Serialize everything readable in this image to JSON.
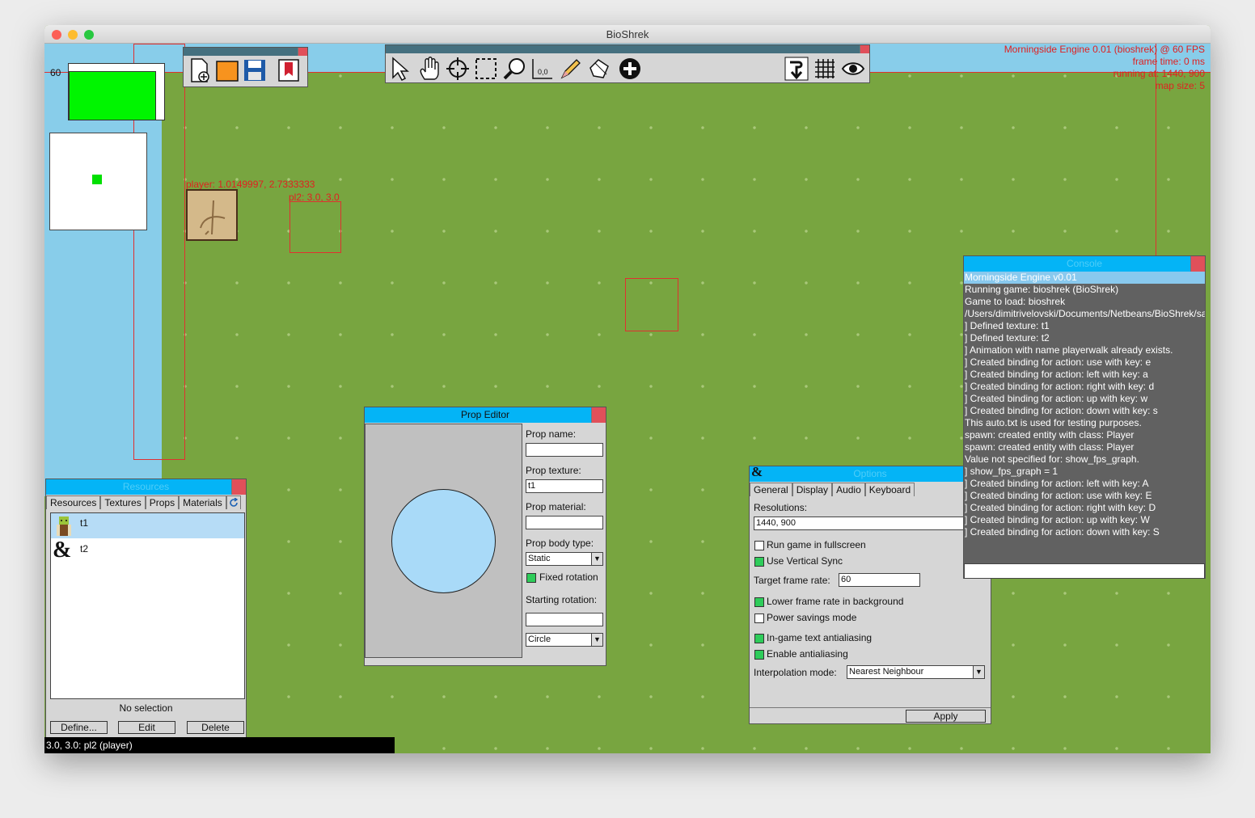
{
  "app": {
    "title": "BioShrek"
  },
  "hud": {
    "minimap_value": "60",
    "player_label": "player: 1.0149997, 2.7333333",
    "pl2_label": "pl2: 3.0, 3.0",
    "stats": [
      "Morningside Engine 0.01 (bioshrek) @ 60 FPS",
      "frame time: 0 ms",
      "running at: 1440, 900",
      "map size: 5"
    ],
    "status_bar": "3.0, 3.0: pl2 (player)"
  },
  "file_toolbar": {
    "icons": [
      "new-file-icon",
      "open-folder-icon",
      "save-icon",
      "bookmark-icon"
    ]
  },
  "tools_toolbar": {
    "icons": [
      "pointer-icon",
      "hand-icon",
      "crosshair-icon",
      "marquee-select-icon",
      "zoom-icon",
      "coordinates-icon",
      "pencil-icon",
      "polygon-icon",
      "add-icon",
      "step-down-icon",
      "grid-icon",
      "eye-icon"
    ],
    "coords_glyph": "0,0"
  },
  "resources": {
    "title": "Resources",
    "tabs": [
      "Resources",
      "Textures",
      "Props",
      "Materials"
    ],
    "items": [
      {
        "name": "t1",
        "icon": "shrek-thumbnail-icon"
      },
      {
        "name": "t2",
        "icon": "ampersand-icon",
        "glyph": "&"
      }
    ],
    "status": "No selection",
    "buttons": {
      "define": "Define...",
      "edit": "Edit",
      "delete": "Delete"
    }
  },
  "prop_editor": {
    "title": "Prop Editor",
    "prop_name_label": "Prop name:",
    "prop_name_value": "",
    "prop_texture_label": "Prop texture:",
    "prop_texture_value": "t1",
    "prop_material_label": "Prop material:",
    "prop_material_value": "",
    "body_type_label": "Prop body type:",
    "body_type_value": "Static",
    "fixed_rotation_label": "Fixed rotation",
    "fixed_rotation_checked": true,
    "starting_rotation_label": "Starting rotation:",
    "starting_rotation_value": "",
    "shape_value": "Circle",
    "arrow_glyph": "▼"
  },
  "options": {
    "title": "Options",
    "icon_glyph": "&",
    "tabs": [
      "General",
      "Display",
      "Audio",
      "Keyboard"
    ],
    "resolutions_label": "Resolutions:",
    "resolutions_value": "1440, 900",
    "fullscreen_label": "Run game in fullscreen",
    "fullscreen_checked": false,
    "vsync_label": "Use Vertical Sync",
    "vsync_checked": true,
    "target_fps_label": "Target frame rate:",
    "target_fps_value": "60",
    "lower_fps_label": "Lower frame rate in background",
    "lower_fps_checked": true,
    "power_label": "Power savings mode",
    "power_checked": false,
    "text_aa_label": "In-game text antialiasing",
    "text_aa_checked": true,
    "aa_label": "Enable antialiasing",
    "aa_checked": true,
    "interp_label": "Interpolation mode:",
    "interp_value": "Nearest Neighbour",
    "apply_label": "Apply"
  },
  "console": {
    "title": "Console",
    "lines": [
      "Morningside Engine v0.01",
      "Running game: bioshrek (BioShrek)",
      "Game to load: bioshrek",
      "/Users/dimitrivelovski/Documents/Netbeans/BioShrek/sa",
      "] Defined texture: t1",
      "] Defined texture: t2",
      "] Animation with name playerwalk already exists.",
      "] Created binding for action: use with key: e",
      "] Created binding for action: left with key: a",
      "] Created binding for action: right with key: d",
      "] Created binding for action: up with key: w",
      "] Created binding for action: down with key: s",
      "This auto.txt is used for testing purposes.",
      "spawn: created entity with class: Player",
      "spawn: created entity with class: Player",
      "Value not specified for: show_fps_graph.",
      "] show_fps_graph = 1",
      "] Created binding for action: left with key: A",
      "] Created binding for action: use with key: E",
      "] Created binding for action: right with key: D",
      "] Created binding for action: up with key: W",
      "] Created binding for action: down with key: S"
    ],
    "input_value": ""
  },
  "colors": {
    "grass": "#78a540",
    "sky": "#88cdea",
    "title_bar": "#04b4f6",
    "close": "#e0505a",
    "hud_red": "#e02020"
  }
}
